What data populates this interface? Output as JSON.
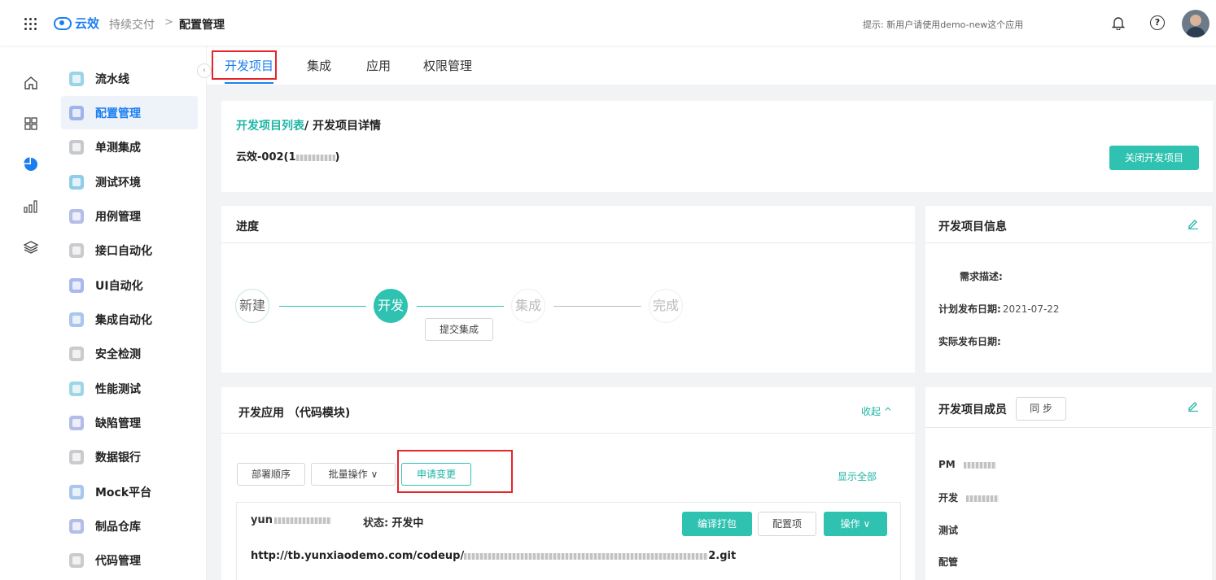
{
  "header": {
    "logo_text": "云效",
    "app_name": "持续交付",
    "separator": ">",
    "current": "配置管理",
    "tip": "提示: 新用户请使用demo-new这个应用",
    "help_symbol": "?"
  },
  "rail": [
    "home-icon",
    "apps-icon",
    "pie-chart-icon",
    "bar-chart-icon",
    "layers-icon"
  ],
  "sidebar": {
    "items": [
      {
        "label": "流水线"
      },
      {
        "label": "配置管理"
      },
      {
        "label": "单测集成"
      },
      {
        "label": "测试环境"
      },
      {
        "label": "用例管理"
      },
      {
        "label": "接口自动化"
      },
      {
        "label": "UI自动化"
      },
      {
        "label": "集成自动化"
      },
      {
        "label": "安全检测"
      },
      {
        "label": "性能测试"
      },
      {
        "label": "缺陷管理"
      },
      {
        "label": "数据银行"
      },
      {
        "label": "Mock平台"
      },
      {
        "label": "制品仓库"
      },
      {
        "label": "代码管理"
      }
    ],
    "active_index": 1,
    "collapse_symbol": "‹"
  },
  "tabs": [
    {
      "label": "开发项目"
    },
    {
      "label": "集成"
    },
    {
      "label": "应用"
    },
    {
      "label": "权限管理"
    }
  ],
  "project": {
    "breadcrumb_link": "开发项目列表",
    "breadcrumb_rest": "/ 开发项目详情",
    "name": "云效-002(1",
    "name_suffix": ")",
    "close_button": "关闭开发项目"
  },
  "progress": {
    "title": "进度",
    "steps": [
      "新建",
      "开发",
      "集成",
      "完成"
    ],
    "submit_button": "提交集成"
  },
  "info": {
    "title": "开发项目信息",
    "desc_label": "需求描述:",
    "plan_label": "计划发布日期:",
    "plan_value": "2021-07-22",
    "actual_label": "实际发布日期:"
  },
  "apps": {
    "title": "开发应用 （代码模块)",
    "collapse_label": "收起",
    "collapse_symbol": "^",
    "deploy_order": "部署顺序",
    "batch_ops": "批量操作",
    "batch_symbol": "∨",
    "apply_change": "申请变更",
    "show_all": "显示全部",
    "app_name": "yun",
    "status_label": "状态:",
    "status_value": "开发中",
    "compile_button": "编译打包",
    "config_button": "配置项",
    "ops_button": "操作",
    "ops_symbol": "∨",
    "repo_url_prefix": "http://tb.yunxiaodemo.com/codeup/",
    "repo_url_suffix": "2.git"
  },
  "members": {
    "title": "开发项目成员",
    "sync_button": "同 步",
    "roles": [
      "PM",
      "开发",
      "测试",
      "配管"
    ]
  },
  "colors": {
    "accent": "#1b7ef0",
    "teal": "#2fc2b1",
    "highlight_border": "#e5252a"
  }
}
